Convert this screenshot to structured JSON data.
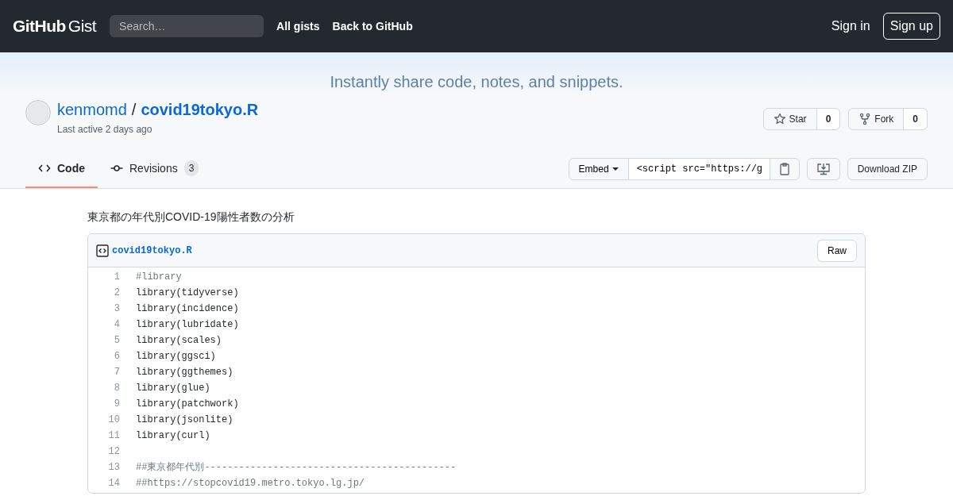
{
  "header": {
    "logo": {
      "brand": "GitHub",
      "product": "Gist"
    },
    "search": {
      "placeholder": "Search…"
    },
    "nav": [
      "All gists",
      "Back to GitHub"
    ],
    "sign_in": "Sign in",
    "sign_up": "Sign up"
  },
  "tagline": "Instantly share code, notes, and snippets.",
  "gist": {
    "owner": "kenmomd",
    "separator": "/",
    "name": "covid19tokyo.R",
    "last_active": "Last active 2 days ago"
  },
  "actions": [
    {
      "kind": "star",
      "label": "Star",
      "count": "0"
    },
    {
      "kind": "fork",
      "label": "Fork",
      "count": "0"
    }
  ],
  "tabs": [
    {
      "kind": "code",
      "label": "Code",
      "selected": true
    },
    {
      "kind": "revisions",
      "label": "Revisions",
      "count": "3",
      "selected": false
    }
  ],
  "embed": {
    "label": "Embed",
    "value": "<script src=\"https://g"
  },
  "download": "Download ZIP",
  "description": "東京都の年代別COVID-19陽性者数の分析",
  "file": {
    "name": "covid19tokyo.R",
    "raw": "Raw",
    "lines": [
      {
        "number": "1",
        "kind": "comment",
        "text": "#library"
      },
      {
        "number": "2",
        "kind": "code",
        "text": "library(tidyverse)"
      },
      {
        "number": "3",
        "kind": "code",
        "text": "library(incidence)"
      },
      {
        "number": "4",
        "kind": "code",
        "text": "library(lubridate)"
      },
      {
        "number": "5",
        "kind": "code",
        "text": "library(scales)"
      },
      {
        "number": "6",
        "kind": "code",
        "text": "library(ggsci)"
      },
      {
        "number": "7",
        "kind": "code",
        "text": "library(ggthemes)"
      },
      {
        "number": "8",
        "kind": "code",
        "text": "library(glue)"
      },
      {
        "number": "9",
        "kind": "code",
        "text": "library(patchwork)"
      },
      {
        "number": "10",
        "kind": "code",
        "text": "library(jsonlite)"
      },
      {
        "number": "11",
        "kind": "code",
        "text": "library(curl)"
      },
      {
        "number": "12",
        "kind": "blank"
      },
      {
        "number": "13",
        "kind": "comment",
        "text": "##東京都年代別--------------------------------------------"
      },
      {
        "number": "14",
        "kind": "comment",
        "text": "##https://stopcovid19.metro.tokyo.lg.jp/"
      }
    ]
  }
}
